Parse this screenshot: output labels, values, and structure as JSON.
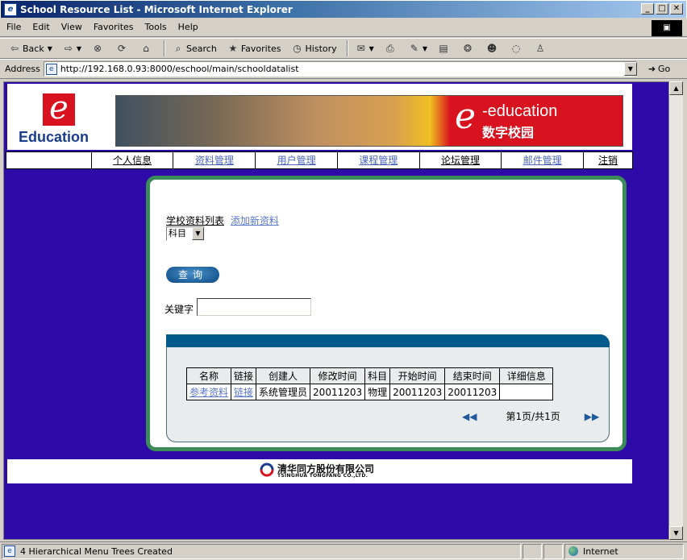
{
  "window": {
    "title": "School Resource List - Microsoft Internet Explorer",
    "minimize": "_",
    "maximize": "□",
    "close": "✕"
  },
  "menu": [
    "File",
    "Edit",
    "View",
    "Favorites",
    "Tools",
    "Help"
  ],
  "toolbar": {
    "back": "Back",
    "search": "Search",
    "favorites": "Favorites",
    "history": "History"
  },
  "address": {
    "label": "Address",
    "url": "http://192.168.0.93:8000/eschool/main/schooldatalist",
    "go": "Go"
  },
  "header": {
    "logo_letter": "e",
    "logo_text": "Education",
    "banner_e": "e",
    "banner_subtitle": "-education",
    "banner_cn": "数字校园"
  },
  "nav": [
    {
      "label": "个人信息",
      "style": "dark"
    },
    {
      "label": "资料管理",
      "style": "light"
    },
    {
      "label": "用户管理",
      "style": "light"
    },
    {
      "label": "课程管理",
      "style": "light"
    },
    {
      "label": "论坛管理",
      "style": "dark"
    },
    {
      "label": "邮件管理",
      "style": "light"
    },
    {
      "label": "注销",
      "style": "dark"
    }
  ],
  "main": {
    "list_link": "学校资料列表",
    "add_link": "添加新资料",
    "subject_select": "科目",
    "query_button": "查询",
    "keyword_label": "关键字",
    "keyword_value": ""
  },
  "table": {
    "columns": [
      "名称",
      "链接",
      "创建人",
      "修改时间",
      "科目",
      "开始时间",
      "结束时间",
      "详细信息"
    ],
    "rows": [
      [
        "参考资料",
        "链接",
        "系统管理员",
        "20011203",
        "物理",
        "20011203",
        "20011203",
        ""
      ]
    ]
  },
  "pager": {
    "prev_icon": "double-left-arrow",
    "text": "第1页/共1页",
    "next_icon": "double-right-arrow"
  },
  "footer": {
    "company_cn": "清华同方股份有限公司",
    "company_en": "TSINGHUA TONGFANG CO.,LTD."
  },
  "status": {
    "text": "4 Hierarchical Menu Trees Created",
    "zone": "Internet"
  },
  "colors": {
    "page_bg": "#2e0aa8",
    "panel_border": "#3c8c5a",
    "table_header_bar": "#005a8c",
    "brand_red": "#d8121f"
  }
}
